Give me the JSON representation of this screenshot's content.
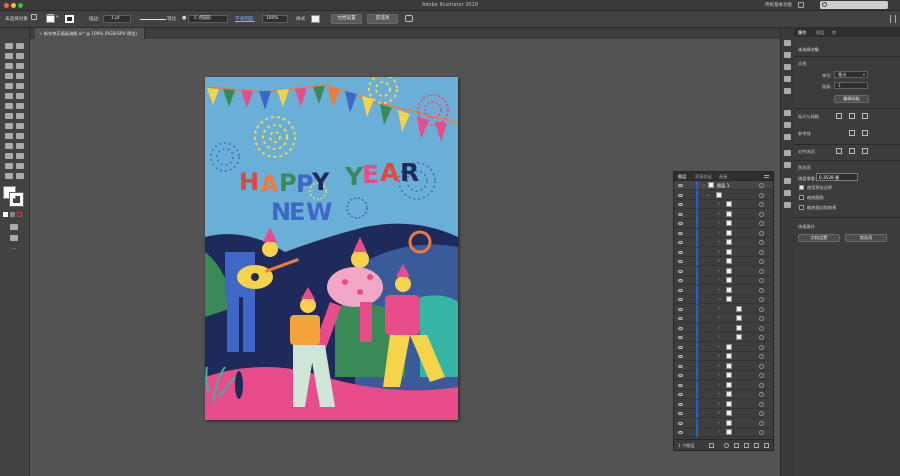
{
  "window": {
    "app_title": "Adobe Illustrator 2019",
    "workspace": "传统基本功能"
  },
  "controlbar": {
    "selection": "未选择对象",
    "stroke_label": "描边:",
    "stroke_value": "1 pt",
    "stroke_style": "等比",
    "brush": "5 点圆形",
    "opacity_label": "不透明度:",
    "opacity_value": "100%",
    "style_label": "样式:",
    "doc_setup": "文档设置",
    "preferences": "首选项"
  },
  "document_tab": {
    "label": "新年快乐插画海报.ai* @ 100% (RGB/GPU 预览)"
  },
  "artwork": {
    "word1": [
      "H",
      "A",
      "P",
      "P",
      "Y"
    ],
    "word2": [
      "Y",
      "E",
      "A",
      "R"
    ],
    "word3": [
      "N",
      "E",
      "W"
    ],
    "colors": {
      "sky": "#6aafd6",
      "pink": "#e84c8b",
      "yellow": "#f7d34b",
      "orange": "#f07a3c",
      "navy": "#1d2a5b",
      "green": "#3a8a58",
      "blue": "#3f67c8",
      "red": "#e2463f"
    }
  },
  "properties_panel": {
    "tab_properties": "属性",
    "tab_layers": "图层",
    "tab_libraries": "库",
    "no_selection": "未选择对象",
    "document_heading": "文档",
    "units_label": "单位:",
    "units_value": "毫米",
    "artboard_label": "画板:",
    "artboard_value": "1",
    "edit_artboards": "编辑画板",
    "rulers_grids": "标尺与网格",
    "guides": "参考线",
    "align": "对齐选项",
    "preferences_heading": "首选项",
    "keyboard_increment_label": "键盘增量:",
    "keyboard_increment_value": "0.3528 厘",
    "opt_corners": "使用预览边界",
    "opt_scale_corners": "缩放圆角",
    "opt_scale_strokes": "缩放描边和效果",
    "quick_actions": "快速操作",
    "btn_doc_setup": "文档设置",
    "btn_preferences": "首选项"
  },
  "layers_panel": {
    "tab_layers": "图层",
    "tab_asset_export": "资源导出",
    "tab_artboards": "画板",
    "layer_name": "图层 1",
    "footer_count": "1 个图层"
  }
}
